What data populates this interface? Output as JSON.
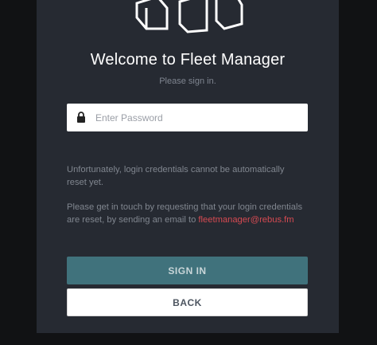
{
  "logo": {
    "icon": "fleet-manager-logo-icon"
  },
  "login": {
    "title": "Welcome to Fleet Manager",
    "subtitle": "Please sign in.",
    "password_placeholder": "Enter Password",
    "password_value": "",
    "lock_icon": "lock-icon"
  },
  "info": {
    "reset_notice": "Unfortunately, login credentials cannot be automatically reset yet.",
    "contact_text": "Please get in touch by requesting that your login credentials are reset, by sending an email to",
    "email": "fleetmanager@rebus.fm"
  },
  "buttons": {
    "sign_in": "SIGN IN",
    "back": "BACK"
  },
  "colors": {
    "background": "#111214",
    "card": "#262a32",
    "primary_button": "#40727c",
    "link": "#d64a52"
  }
}
